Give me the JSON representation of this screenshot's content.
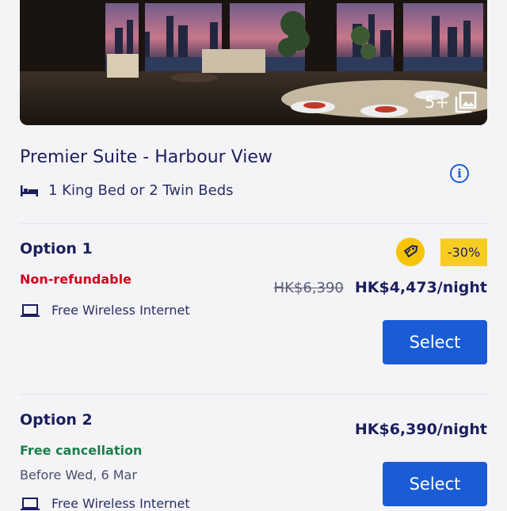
{
  "hero": {
    "photo_count": "5+"
  },
  "room": {
    "title": "Premier Suite - Harbour View",
    "beds": "1 King Bed or 2 Twin Beds"
  },
  "options": [
    {
      "title": "Option 1",
      "policy": "Non-refundable",
      "amenity": "Free Wireless Internet",
      "discount": "-30%",
      "price_old": "HK$6,390",
      "price_now": "HK$4,473/night",
      "select_label": "Select"
    },
    {
      "title": "Option 2",
      "policy": "Free cancellation",
      "cancel_before": "Before Wed, 6 Mar",
      "amenity": "Free Wireless Internet",
      "price_now": "HK$6,390/night",
      "select_label": "Select"
    }
  ],
  "colors": {
    "accent": "#1a5cd6",
    "navy": "#1b1f5e",
    "non_refundable": "#d0021b",
    "free_cancel": "#1b7f4b",
    "deal_yellow": "#f6c400"
  },
  "icons": {
    "bed": "bed-icon",
    "info": "info-icon",
    "photos": "gallery-icon",
    "deal": "price-tag-icon",
    "wifi": "laptop-icon"
  }
}
